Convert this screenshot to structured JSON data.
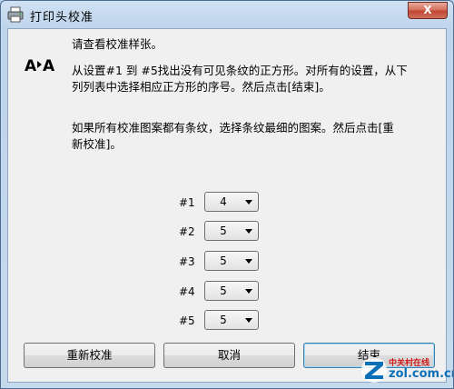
{
  "window": {
    "title": "打印头校准",
    "close_glyph": "X"
  },
  "instructions": {
    "line1": "请查看校准样张。",
    "para2_a": "从设置#1 到 #5找出没有可见条纹的正方形。对所有的设置，从下",
    "para2_b": "列列表中选择相应正方形的序号。然后点击[结束]。",
    "para3_a": "如果所有校准图案都有条纹，选择条纹最细的图案。然后点击[重",
    "para3_b": "新校准]。"
  },
  "settings": [
    {
      "label": "#1",
      "value": "4"
    },
    {
      "label": "#2",
      "value": "5"
    },
    {
      "label": "#3",
      "value": "5"
    },
    {
      "label": "#4",
      "value": "5"
    },
    {
      "label": "#5",
      "value": "5"
    }
  ],
  "buttons": {
    "recalibrate": "重新校准",
    "cancel": "取消",
    "finish": "结束"
  },
  "watermark": {
    "top": "中关村在线",
    "bottom": "zol.com.cn"
  },
  "colors": {
    "accent": "#3c7fb1",
    "close": "#c04631"
  }
}
